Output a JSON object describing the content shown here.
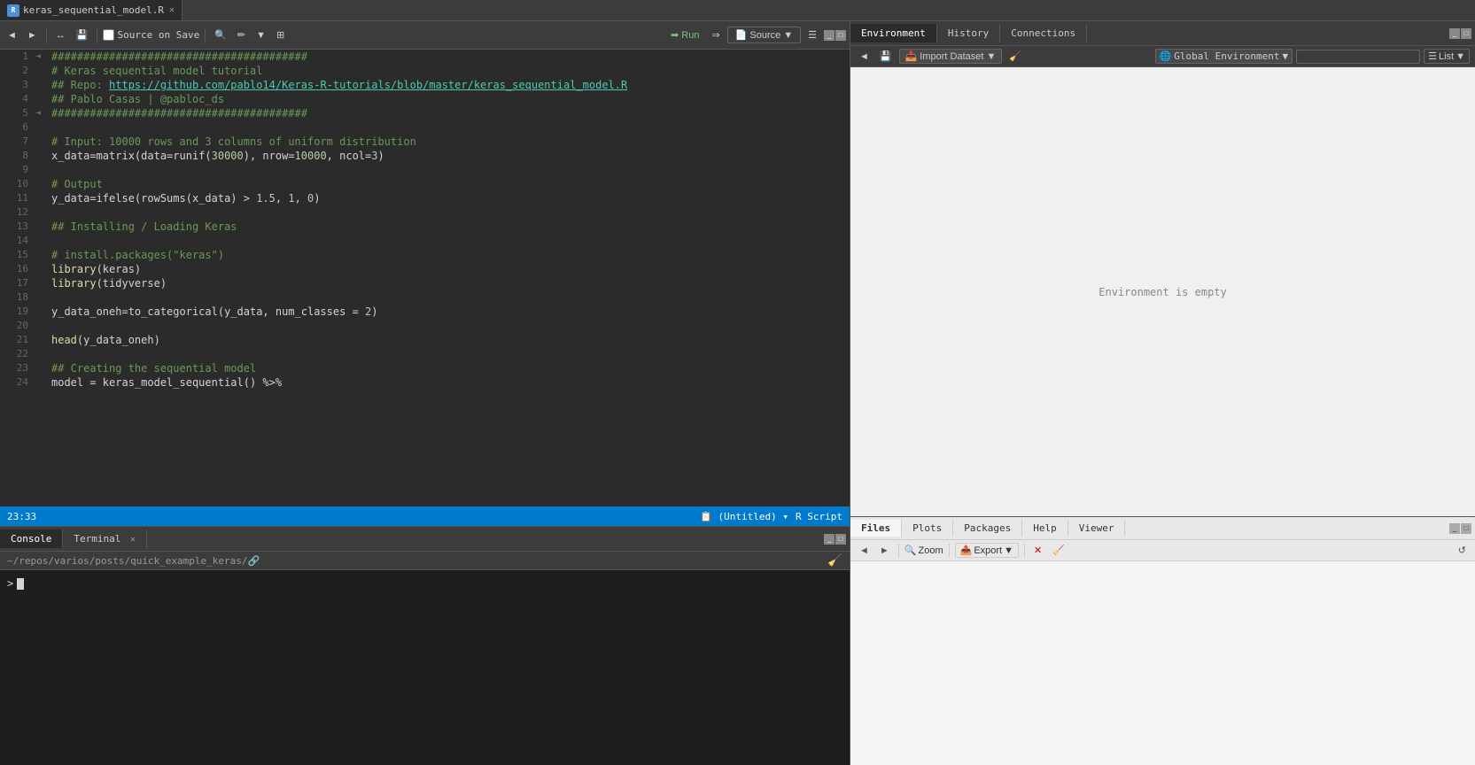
{
  "tab": {
    "filename": "keras_sequential_model.R",
    "icon_text": "R"
  },
  "editor_toolbar": {
    "source_on_save": "Source on Save",
    "run_label": "Run",
    "source_label": "Source"
  },
  "code_lines": [
    {
      "num": 1,
      "arrow": "◄",
      "content": "########################################"
    },
    {
      "num": 2,
      "arrow": " ",
      "content": "# Keras sequential model tutorial"
    },
    {
      "num": 3,
      "arrow": " ",
      "content": "## Repo: https://github.com/pablo14/Keras-R-tutorials/blob/master/keras_sequential_model.R"
    },
    {
      "num": 4,
      "arrow": " ",
      "content": "## Pablo Casas | @pabloc_ds"
    },
    {
      "num": 5,
      "arrow": "◄",
      "content": "########################################"
    },
    {
      "num": 6,
      "arrow": " ",
      "content": ""
    },
    {
      "num": 7,
      "arrow": " ",
      "content": "# Input: 10000 rows and 3 columns of uniform distribution"
    },
    {
      "num": 8,
      "arrow": " ",
      "content": "x_data=matrix(data=runif(30000), nrow=10000, ncol=3)"
    },
    {
      "num": 9,
      "arrow": " ",
      "content": ""
    },
    {
      "num": 10,
      "arrow": " ",
      "content": "# Output"
    },
    {
      "num": 11,
      "arrow": " ",
      "content": "y_data=ifelse(rowSums(x_data) > 1.5, 1, 0)"
    },
    {
      "num": 12,
      "arrow": " ",
      "content": ""
    },
    {
      "num": 13,
      "arrow": " ",
      "content": "## Installing / Loading Keras"
    },
    {
      "num": 14,
      "arrow": " ",
      "content": ""
    },
    {
      "num": 15,
      "arrow": " ",
      "content": "# install.packages(\"keras\")"
    },
    {
      "num": 16,
      "arrow": " ",
      "content": "library(keras)"
    },
    {
      "num": 17,
      "arrow": " ",
      "content": "library(tidyverse)"
    },
    {
      "num": 18,
      "arrow": " ",
      "content": ""
    },
    {
      "num": 19,
      "arrow": " ",
      "content": "y_data_oneh=to_categorical(y_data, num_classes = 2)"
    },
    {
      "num": 20,
      "arrow": " ",
      "content": ""
    },
    {
      "num": 21,
      "arrow": " ",
      "content": "head(y_data_oneh)"
    },
    {
      "num": 22,
      "arrow": " ",
      "content": ""
    },
    {
      "num": 23,
      "arrow": " ",
      "content": "## Creating the sequential model"
    },
    {
      "num": 24,
      "arrow": " ",
      "content": "model = keras_model_sequential() %>%"
    }
  ],
  "status_bar": {
    "position": "23:33",
    "file_type": "R Script",
    "untitled": "(Untitled)"
  },
  "console": {
    "tab_label": "Console",
    "terminal_label": "Terminal",
    "working_dir": "~/repos/varios/posts/quick_example_keras/",
    "prompt": ">"
  },
  "env_panel": {
    "environment_tab": "Environment",
    "history_tab": "History",
    "connections_tab": "Connections",
    "global_env": "Global Environment",
    "empty_msg": "Environment is empty",
    "import_label": "Import Dataset",
    "list_label": "List",
    "search_placeholder": ""
  },
  "files_panel": {
    "files_tab": "Files",
    "plots_tab": "Plots",
    "packages_tab": "Packages",
    "help_tab": "Help",
    "viewer_tab": "Viewer",
    "zoom_label": "Zoom",
    "export_label": "Export"
  }
}
